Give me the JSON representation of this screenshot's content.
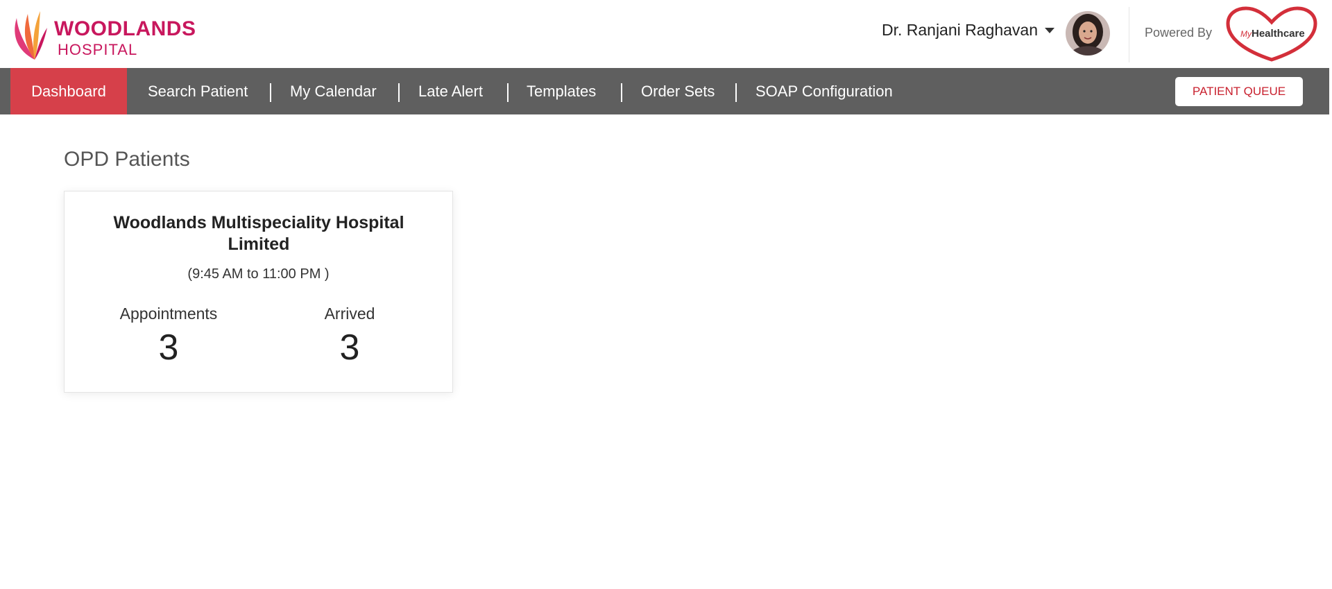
{
  "brand": {
    "line1": "WOODLANDS",
    "line2": "HOSPITAL"
  },
  "user": {
    "name": "Dr. Ranjani Raghavan"
  },
  "powered_by": {
    "label": "Powered By",
    "logo_prefix": "My",
    "logo_text": "Healthcare"
  },
  "nav": {
    "items": [
      {
        "label": "Dashboard"
      },
      {
        "label": "Search Patient"
      },
      {
        "label": "My Calendar"
      },
      {
        "label": "Late Alert"
      },
      {
        "label": "Templates"
      },
      {
        "label": "Order Sets"
      },
      {
        "label": "SOAP Configuration"
      }
    ],
    "queue_button": "PATIENT QUEUE"
  },
  "main": {
    "section_title": "OPD Patients",
    "card": {
      "hospital": "Woodlands Multispeciality Hospital Limited",
      "timing": "(9:45 AM to 11:00 PM )",
      "appointments_label": "Appointments",
      "appointments_value": "3",
      "arrived_label": "Arrived",
      "arrived_value": "3"
    }
  },
  "colors": {
    "brand": "#c8175d",
    "nav_bg": "#5f5f5f",
    "nav_active": "#d6404a",
    "queue_text": "#c8202e"
  }
}
